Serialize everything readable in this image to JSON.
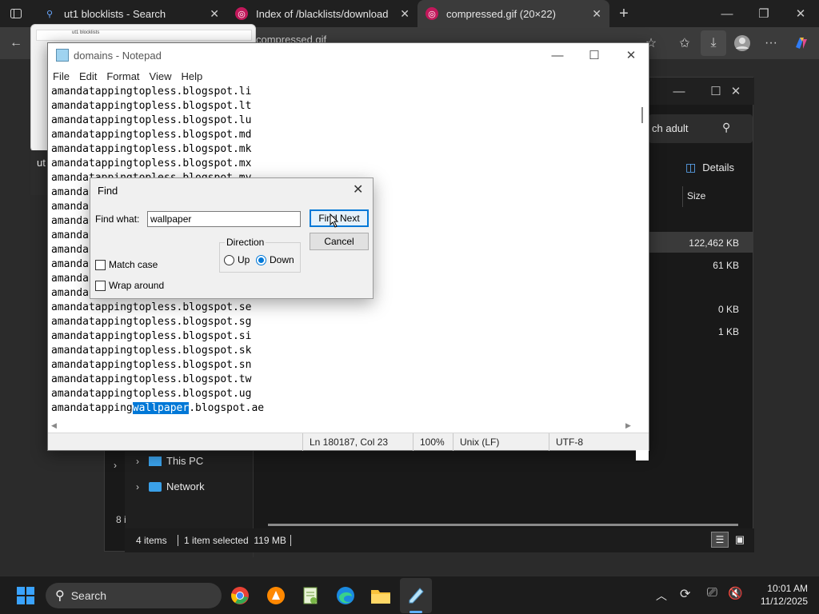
{
  "browser": {
    "tabs": [
      {
        "label": "ut1 blocklists - Search",
        "icon": "search-icon",
        "active": false
      },
      {
        "label": "Index of /blacklists/download",
        "icon": "target-icon",
        "active": false
      },
      {
        "label": "compressed.gif (20×22)",
        "icon": "target-icon",
        "active": true
      }
    ],
    "address_fragment": "compressed.gif",
    "preview_text": "ut",
    "preview_search": "ut1 blocklists"
  },
  "explorer": {
    "search_text": "ch adult",
    "details_label": "Details",
    "col_size": "Size",
    "sizes": [
      "122,462 KB",
      "61 KB",
      "0 KB",
      "1 KB"
    ],
    "nav": [
      "This PC",
      "Network"
    ],
    "status_items": "4 items",
    "status_selected": "1 item selected  119 MB",
    "left_count": "8 i"
  },
  "notepad": {
    "title": "domains - Notepad",
    "menu": [
      "File",
      "Edit",
      "Format",
      "View",
      "Help"
    ],
    "lines": [
      "amandatappingtopless.blogspot.li",
      "amandatappingtopless.blogspot.lt",
      "amandatappingtopless.blogspot.lu",
      "amandatappingtopless.blogspot.md",
      "amandatappingtopless.blogspot.mk",
      "amandatappingtopless.blogspot.mx",
      "amandatappingtopless.blogspot.my",
      "amanda",
      "amanda",
      "amanda",
      "amanda",
      "amanda",
      "amanda",
      "amanda",
      "amanda",
      "amandatappingtopless.blogspot.se",
      "amandatappingtopless.blogspot.sg",
      "amandatappingtopless.blogspot.si",
      "amandatappingtopless.blogspot.sk",
      "amandatappingtopless.blogspot.sn",
      "amandatappingtopless.blogspot.tw",
      "amandatappingtopless.blogspot.ug"
    ],
    "match_line": {
      "before": "amandatapping",
      "match": "wallpaper",
      "after": ".blogspot.ae"
    },
    "status": {
      "position": "Ln 180187, Col 23",
      "zoom": "100%",
      "eol": "Unix (LF)",
      "encoding": "UTF-8"
    }
  },
  "find_dialog": {
    "title": "Find",
    "find_what_label": "Find what:",
    "find_what_value": "wallpaper",
    "find_next": "Find Next",
    "cancel": "Cancel",
    "direction_label": "Direction",
    "up_label": "Up",
    "down_label": "Down",
    "direction": "Down",
    "match_case_label": "Match case",
    "wrap_around_label": "Wrap around",
    "match_case": false,
    "wrap_around": false
  },
  "taskbar": {
    "search_label": "Search",
    "time": "10:01 AM",
    "date": "11/12/2025"
  },
  "colors": {
    "accent": "#0078d7",
    "highlight": "#0078d7"
  }
}
